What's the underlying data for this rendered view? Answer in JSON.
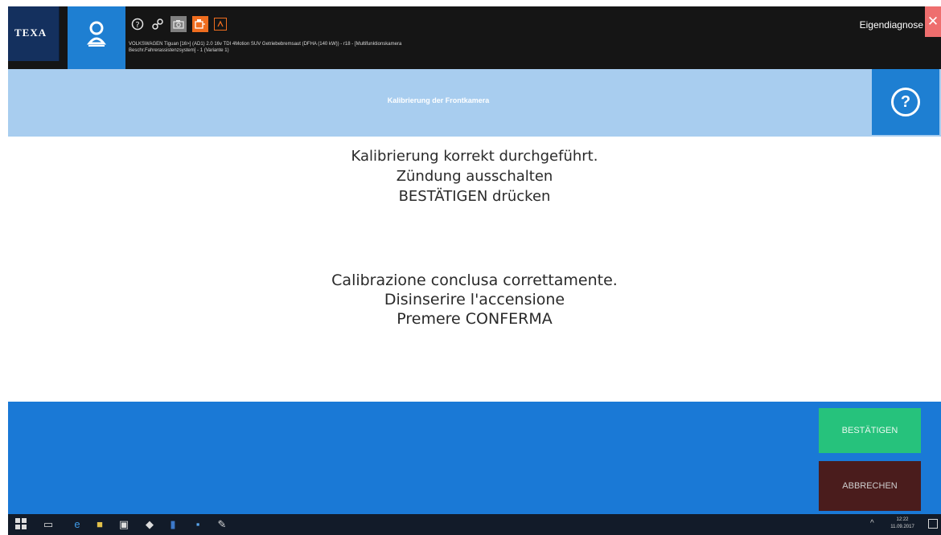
{
  "header": {
    "brand": "TEXA",
    "vehicle_line1": "VOLKSWAGEN Tiguan [16>] (AD1) 2.0 16v TDI 4Motion SUV Getriebebremsaut (DFHA (140 kW)) - r18 - [Multifunktionskamera",
    "vehicle_line2": "Beschr.Fahrerassistenzsystem] - 1 (Variante 1)",
    "self_diagnosis_label": "Eigendiagnose",
    "close_label": "✕",
    "icons": [
      "help-circle-icon",
      "link-icon",
      "camera-icon",
      "car-battery-icon",
      "report-icon"
    ]
  },
  "title_bar": {
    "title": "Kalibrierung der Frontkamera",
    "help_symbol": "?"
  },
  "message": {
    "de": [
      "Kalibrierung korrekt durchgeführt.",
      "Zündung ausschalten",
      "BESTÄTIGEN drücken"
    ],
    "it": [
      "Calibrazione conclusa correttamente.",
      "Disinserire l'accensione",
      "Premere CONFERMA"
    ]
  },
  "actions": {
    "confirm_label": "BESTÄTIGEN",
    "cancel_label": "ABBRECHEN"
  },
  "taskbar": {
    "time": "12:22",
    "date": "11.09.2017"
  },
  "colors": {
    "header_bg": "#151515",
    "brand_bg": "#14305e",
    "accent_blue": "#1e7fd2",
    "title_bar_bg": "#a8cdef",
    "action_bar_bg": "#1a79d6",
    "confirm_green": "#26c27c",
    "cancel_dark_red": "#4a1c1c",
    "close_red": "#ee6e6e",
    "tool_orange": "#ef6d1f"
  }
}
